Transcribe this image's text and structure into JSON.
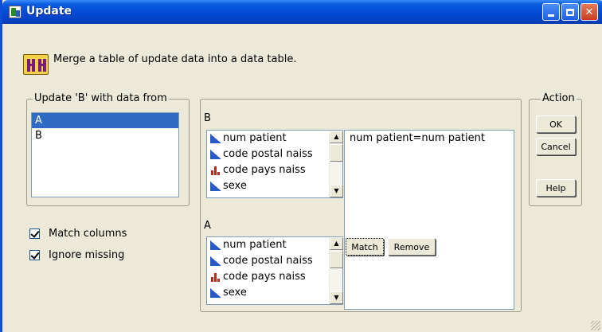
{
  "window": {
    "title": "Update",
    "header_text": "Merge a table of update data into a data table."
  },
  "source_group": {
    "legend": "Update 'B' with data from",
    "items": [
      "A",
      "B"
    ],
    "selected": "A"
  },
  "options": {
    "match_columns": {
      "label": "Match columns",
      "checked": true
    },
    "ignore_missing": {
      "label": "Ignore missing",
      "checked": true
    }
  },
  "columns": {
    "b_label": "B",
    "a_label": "A",
    "b_list": [
      {
        "name": "num patient",
        "icon": "continuous-icon"
      },
      {
        "name": "code postal naiss",
        "icon": "continuous-icon"
      },
      {
        "name": "code pays naiss",
        "icon": "nominal-icon"
      },
      {
        "name": "sexe",
        "icon": "continuous-icon"
      }
    ],
    "a_list": [
      {
        "name": "num patient",
        "icon": "continuous-icon"
      },
      {
        "name": "code postal naiss",
        "icon": "continuous-icon"
      },
      {
        "name": "code pays naiss",
        "icon": "nominal-icon"
      },
      {
        "name": "sexe",
        "icon": "continuous-icon"
      }
    ],
    "matches": [
      "num patient=num patient"
    ],
    "match_button": "Match",
    "remove_button": "Remove"
  },
  "action_group": {
    "legend": "Action",
    "ok": "OK",
    "cancel": "Cancel",
    "help": "Help"
  },
  "colors": {
    "titlebar": "#0549d4",
    "selection": "#316ac5",
    "continuous_icon": "#2a5ac8",
    "nominal_icon": "#c0281a"
  }
}
